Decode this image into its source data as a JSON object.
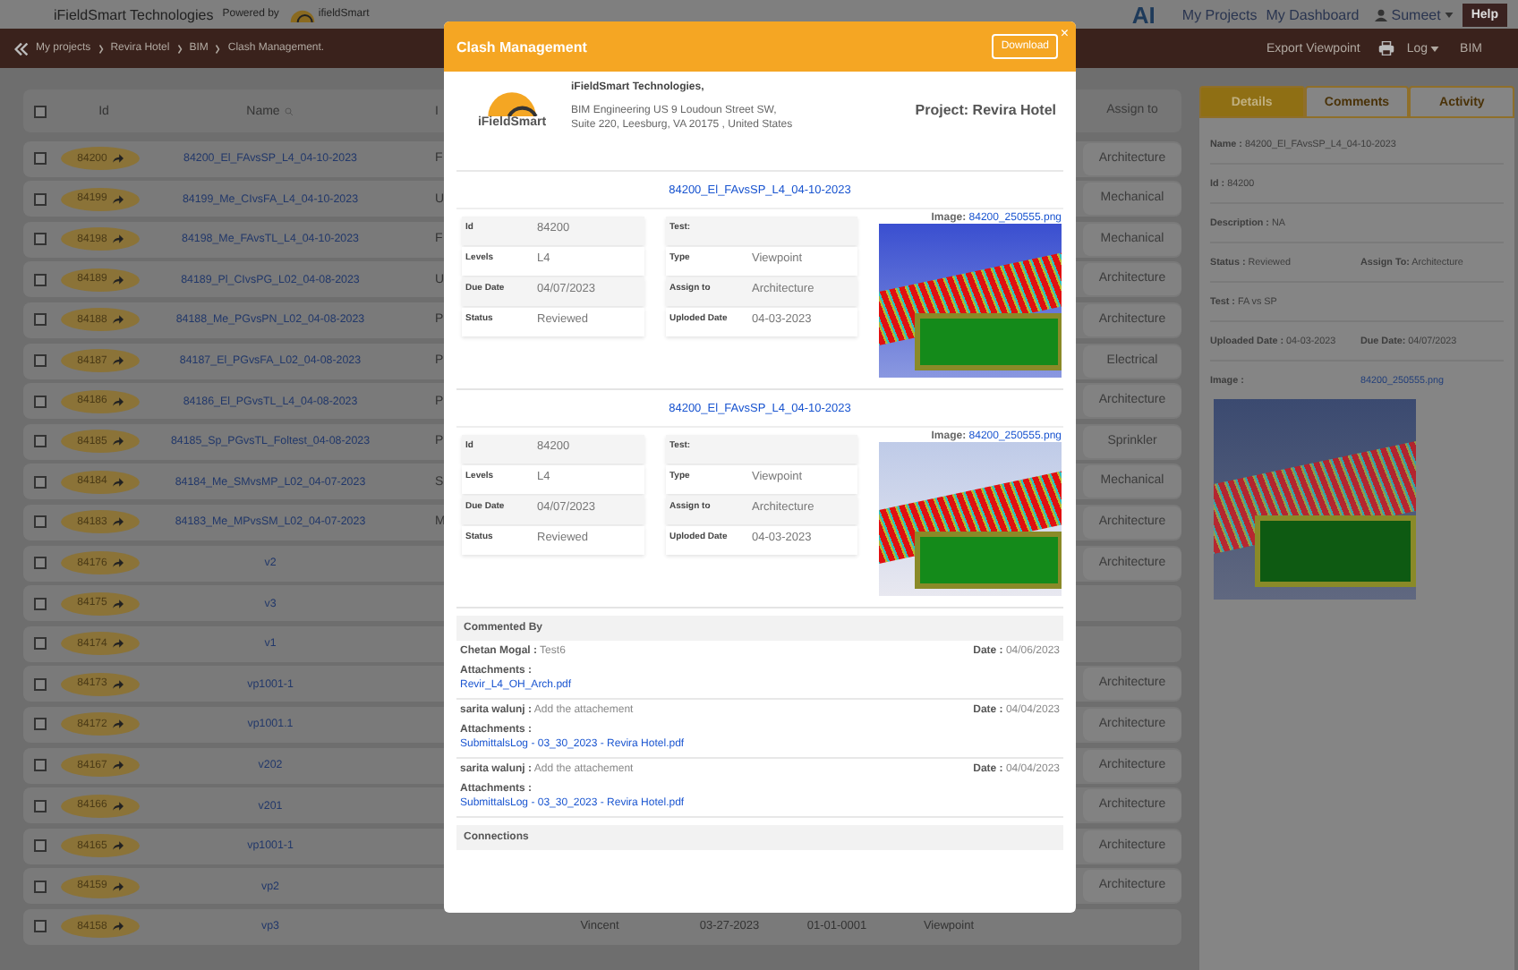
{
  "header": {
    "company": "iFieldSmart Technologies",
    "powered_by": "Powered by",
    "logo_text": "ifieldSmart",
    "ai_logo_text": "AI",
    "nav": [
      "My Projects",
      "My Dashboard"
    ],
    "user": "Sumeet",
    "help": "Help"
  },
  "breadcrumb": [
    "My projects",
    "Revira Hotel",
    "BIM",
    "Clash Management."
  ],
  "toolbar": {
    "export": "Export Viewpoint",
    "log": "Log",
    "bim": "BIM"
  },
  "table": {
    "select_all_checked": false,
    "columns": [
      "Id",
      "Name",
      "I",
      "Assign to"
    ],
    "rows": [
      {
        "checked": false,
        "id": "84200",
        "name": "84200_El_FAvsSP_L4_04-10-2023",
        "column_3": "F",
        "assign_to": "Architecture"
      },
      {
        "checked": false,
        "id": "84199",
        "name": "84199_Me_CIvsFA_L4_04-10-2023",
        "column_3": "U",
        "assign_to": "Mechanical"
      },
      {
        "checked": false,
        "id": "84198",
        "name": "84198_Me_FAvsTL_L4_04-10-2023",
        "column_3": "F",
        "assign_to": "Mechanical"
      },
      {
        "checked": false,
        "id": "84189",
        "name": "84189_Pl_CIvsPG_L02_04-08-2023",
        "column_3": "U",
        "assign_to": "Architecture"
      },
      {
        "checked": false,
        "id": "84188",
        "name": "84188_Me_PGvsPN_L02_04-08-2023",
        "column_3": "P",
        "assign_to": "Architecture"
      },
      {
        "checked": false,
        "id": "84187",
        "name": "84187_El_PGvsFA_L02_04-08-2023",
        "column_3": "P",
        "assign_to": "Electrical"
      },
      {
        "checked": false,
        "id": "84186",
        "name": "84186_El_PGvsTL_L4_04-08-2023",
        "column_3": "P",
        "assign_to": "Architecture"
      },
      {
        "checked": false,
        "id": "84185",
        "name": "84185_Sp_PGvsTL_Foltest_04-08-2023",
        "column_3": "P",
        "assign_to": "Sprinkler"
      },
      {
        "checked": false,
        "id": "84184",
        "name": "84184_Me_SMvsMP_L02_04-07-2023",
        "column_3": "S",
        "assign_to": "Mechanical"
      },
      {
        "checked": false,
        "id": "84183",
        "name": "84183_Me_MPvsSM_L02_04-07-2023",
        "column_3": "M",
        "assign_to": "Architecture"
      },
      {
        "checked": false,
        "id": "84176",
        "name": "v2",
        "assign_to": "Architecture"
      },
      {
        "checked": false,
        "id": "84175",
        "name": "v3"
      },
      {
        "checked": false,
        "id": "84174",
        "name": "v1"
      },
      {
        "checked": false,
        "id": "84173",
        "name": "vp1001-1",
        "assign_to": "Architecture"
      },
      {
        "checked": false,
        "id": "84172",
        "name": "vp1001.1",
        "assign_to": "Architecture"
      },
      {
        "checked": false,
        "id": "84167",
        "name": "v202",
        "assign_to": "Architecture"
      },
      {
        "checked": false,
        "id": "84166",
        "name": "v201",
        "assign_to": "Architecture"
      },
      {
        "checked": false,
        "id": "84165",
        "name": "vp1001-1",
        "assign_to": "Architecture"
      },
      {
        "checked": false,
        "id": "84159",
        "name": "vp2",
        "assign_to": "Architecture"
      },
      {
        "checked": false,
        "id": "84158",
        "name": "vp3",
        "column_4": "Vincent",
        "column_5": "03-27-2023",
        "column_6": "01-01-0001",
        "column_7": "Viewpoint"
      }
    ]
  },
  "details": {
    "tabs": [
      {
        "label": "Details",
        "selected": true
      },
      {
        "label": "Comments",
        "selected": false
      },
      {
        "label": "Activity",
        "selected": false
      }
    ],
    "rows": [
      [
        {
          "label": "Name :",
          "value": "84200_El_FAvsSP_L4_04-10-2023"
        }
      ],
      [
        {
          "label": "Id :",
          "value": "84200"
        }
      ],
      [
        {
          "label": "Description :",
          "value": "NA"
        }
      ],
      [
        {
          "label": "Status :",
          "value": "Reviewed"
        },
        {
          "label": "Assign To:",
          "value": "Architecture"
        }
      ],
      [
        {
          "label": "Test :",
          "value": "FA vs SP"
        }
      ],
      [
        {
          "label": "Uploaded Date :",
          "value": "04-03-2023"
        },
        {
          "label": "Due Date:",
          "value": "04/07/2023"
        }
      ]
    ],
    "image_label": "Image :",
    "image_file": "84200_250555.png"
  },
  "modal": {
    "title": "Clash Management",
    "download": "Download",
    "close": "×",
    "company": {
      "logo_text": "iFieldSmart",
      "name": "iFieldSmart Technologies,",
      "address": "BIM Engineering US 9 Loudoun Street SW, Suite 220, Leesburg, VA 20175 , United States"
    },
    "project": "Project: Revira Hotel",
    "clashes": [
      {
        "title": "84200_El_FAvsSP_L4_04-10-2023",
        "image_label": "Image:",
        "image_file": "84200_250555.png",
        "left": [
          {
            "label": "Id",
            "value": "84200"
          },
          {
            "label": "Levels",
            "value": "L4"
          },
          {
            "label": "Due Date",
            "value": "04/07/2023"
          },
          {
            "label": "Status",
            "value": "Reviewed"
          }
        ],
        "right": [
          {
            "label": "Test:"
          },
          {
            "label": "Type",
            "value": "Viewpoint"
          },
          {
            "label": "Assign to",
            "value": "Architecture"
          },
          {
            "label": "Uploded Date",
            "value": "04-03-2023"
          }
        ]
      },
      {
        "title": "84200_El_FAvsSP_L4_04-10-2023",
        "image_label": "Image:",
        "image_file": "84200_250555.png",
        "left": [
          {
            "label": "Id",
            "value": "84200"
          },
          {
            "label": "Levels",
            "value": "L4"
          },
          {
            "label": "Due Date",
            "value": "04/07/2023"
          },
          {
            "label": "Status",
            "value": "Reviewed"
          }
        ],
        "right": [
          {
            "label": "Test:"
          },
          {
            "label": "Type",
            "value": "Viewpoint"
          },
          {
            "label": "Assign to",
            "value": "Architecture"
          },
          {
            "label": "Uploded Date",
            "value": "04-03-2023"
          }
        ]
      }
    ],
    "comments_heading": "Commented By",
    "comments": [
      {
        "author": "Chetan Mogal :",
        "text": "Test6",
        "date_label": "Date :",
        "date": "04/06/2023",
        "attachments_label": "Attachments :",
        "attachment": "Revir_L4_OH_Arch.pdf"
      },
      {
        "author": "sarita walunj :",
        "text": "Add the attachement",
        "date_label": "Date :",
        "date": "04/04/2023",
        "attachments_label": "Attachments :",
        "attachment": "SubmittalsLog - 03_30_2023 - Revira Hotel.pdf"
      },
      {
        "author": "sarita walunj :",
        "text": "Add the attachement",
        "date_label": "Date :",
        "date": "04/04/2023",
        "attachments_label": "Attachments :",
        "attachment": "SubmittalsLog - 03_30_2023 - Revira Hotel.pdf"
      }
    ],
    "connections_heading": "Connections"
  }
}
